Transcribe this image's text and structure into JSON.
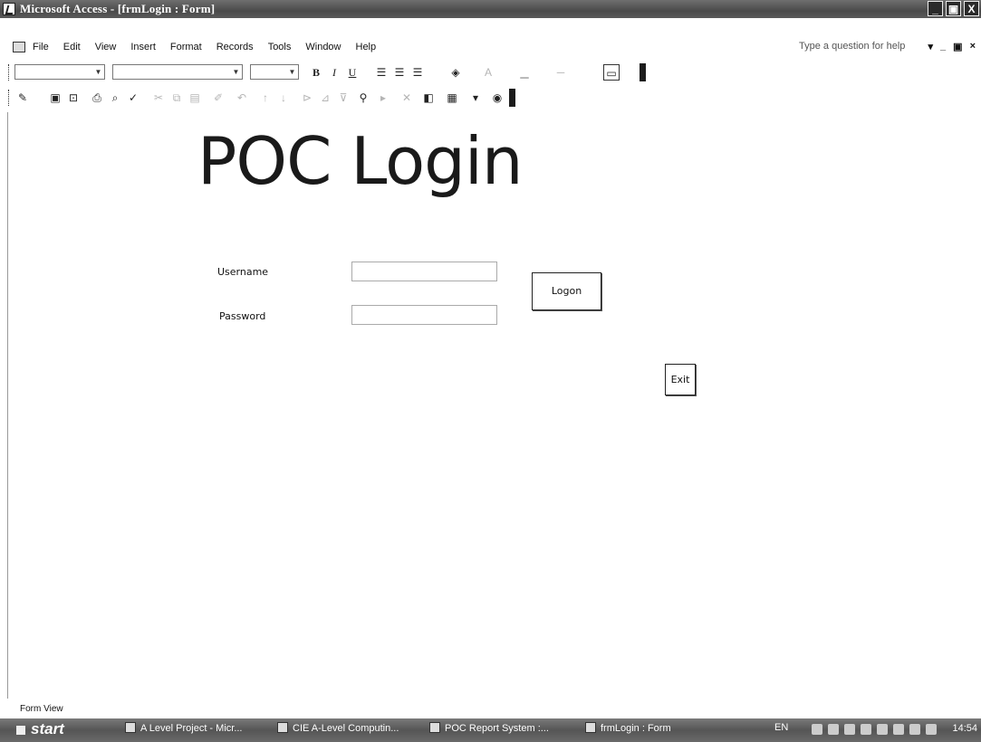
{
  "window": {
    "title": "Microsoft Access - [frmLogin : Form]",
    "controls": [
      "_",
      "▣",
      "X"
    ]
  },
  "menubar": {
    "items": [
      "File",
      "Edit",
      "View",
      "Insert",
      "Format",
      "Records",
      "Tools",
      "Window",
      "Help"
    ],
    "help_placeholder": "Type a question for help",
    "mdi_controls": [
      "▾",
      "_",
      "▣",
      "×"
    ]
  },
  "formatting": {
    "bold": "B",
    "italic": "I",
    "underline": "U"
  },
  "form": {
    "title": "POC Login",
    "username_label": "Username",
    "username_value": "",
    "password_label": "Password",
    "password_value": "",
    "logon_label": "Logon",
    "exit_label": "Exit"
  },
  "statusbar": {
    "text": "Form View"
  },
  "taskbar": {
    "start": "start",
    "tasks": [
      "A Level Project - Micr...",
      "CIE A-Level Computin...",
      "POC Report System :...",
      "frmLogin : Form"
    ],
    "language": "EN",
    "clock": "14:54"
  }
}
